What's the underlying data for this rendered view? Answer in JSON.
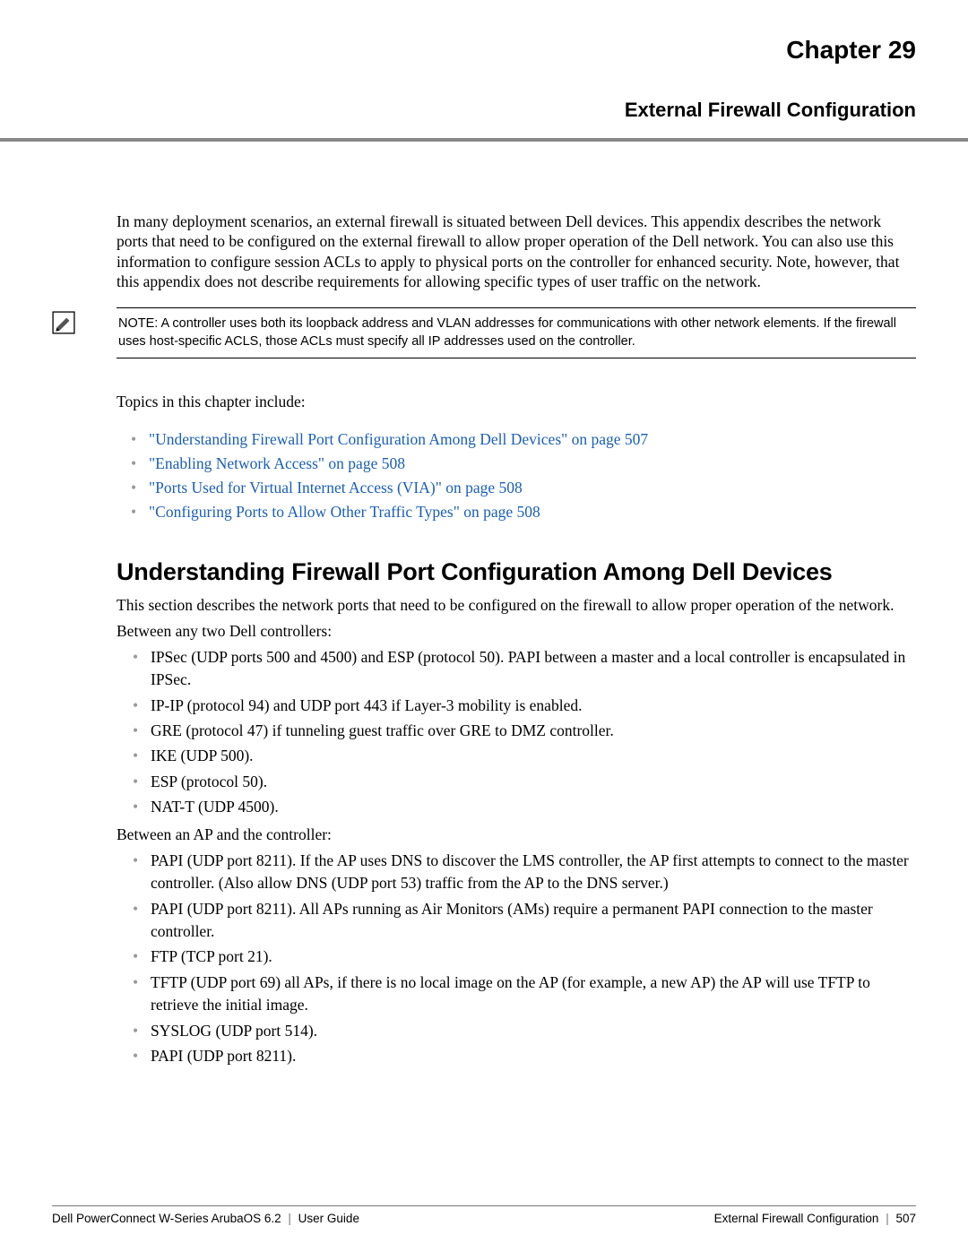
{
  "chapter_label": "Chapter 29",
  "chapter_title": "External Firewall Configuration",
  "intro": "In many deployment scenarios, an external firewall is situated between Dell devices. This appendix describes the network ports that need to be configured on the external firewall to allow proper operation of the Dell network. You can also use this information to configure session ACLs to apply to physical ports on the controller for enhanced security. Note, however, that this appendix does not describe requirements for allowing specific types of user traffic on the network.",
  "note": "NOTE: A controller uses both its loopback address and VLAN addresses for communications with other network elements. If the firewall uses host-specific ACLS, those ACLs must specify all IP addresses used on the controller.",
  "topics_lead": "Topics in this chapter include:",
  "topic_links": [
    "\"Understanding Firewall Port Configuration Among Dell Devices\" on page 507",
    "\"Enabling Network Access\" on page 508",
    "\"Ports Used for Virtual Internet Access (VIA)\" on page 508",
    "\"Configuring Ports to Allow Other Traffic Types\" on page 508"
  ],
  "section_heading": "Understanding Firewall Port Configuration Among Dell Devices",
  "section_intro": "This section describes the network ports that need to be configured on the firewall to allow proper operation of the network.",
  "ctrl_lead": "Between any two Dell controllers:",
  "ctrl_items": [
    "IPSec (UDP ports 500 and 4500) and ESP (protocol 50). PAPI between a master and a local controller is encapsulated in IPSec.",
    "IP-IP (protocol 94) and UDP port 443 if Layer-3 mobility is enabled.",
    "GRE (protocol 47) if tunneling guest traffic over GRE to DMZ controller.",
    "IKE (UDP 500).",
    "ESP (protocol 50).",
    "NAT-T (UDP 4500)."
  ],
  "ap_lead": "Between an AP and the controller:",
  "ap_items": [
    "PAPI (UDP port 8211). If the AP uses DNS to discover the LMS controller, the AP first attempts to connect to the master controller. (Also allow DNS (UDP port 53) traffic from the AP to the DNS server.)",
    "PAPI (UDP port 8211). All APs running as Air Monitors (AMs) require a permanent PAPI connection to the master controller.",
    "FTP (TCP port 21).",
    "TFTP (UDP port 69) all APs, if there is no local image on the AP (for example, a new AP) the AP will use TFTP to retrieve the initial image.",
    "SYSLOG (UDP port 514).",
    "PAPI (UDP port 8211)."
  ],
  "footer": {
    "left_product": "Dell PowerConnect W-Series ArubaOS 6.2",
    "left_doc": "User Guide",
    "right_section": "External Firewall Configuration",
    "right_page": "507"
  }
}
